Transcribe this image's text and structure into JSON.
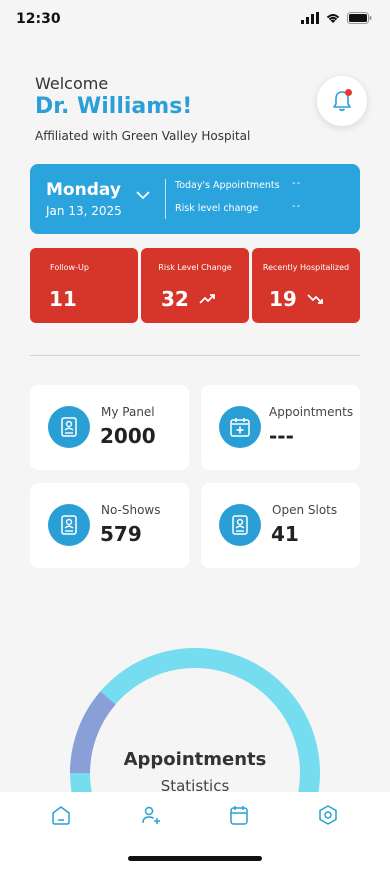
{
  "status": {
    "time": "12:30"
  },
  "header": {
    "welcome": "Welcome",
    "doctor_name": "Dr. Williams!",
    "affiliation": "Affiliated with Green Valley Hospital"
  },
  "day_card": {
    "day": "Monday",
    "date": "Jan 13, 2025",
    "todays_appointments_label": "Today's Appointments",
    "todays_appointments_value": "--",
    "risk_change_label": "Risk level change",
    "risk_change_value": "--",
    "color": "#2ba3dd"
  },
  "alerts": [
    {
      "label": "Follow-Up",
      "value": "11",
      "trend": ""
    },
    {
      "label": "Risk Level Change",
      "value": "32",
      "trend": "up"
    },
    {
      "label": "Recently Hospitalized",
      "value": "19",
      "trend": "down"
    }
  ],
  "alert_color": "#d6352a",
  "stats": [
    {
      "label": "My Panel",
      "value": "2000",
      "icon": "profile-card-icon"
    },
    {
      "label": "Appointments",
      "value": "---",
      "icon": "calendar-plus-icon"
    },
    {
      "label": "No-Shows",
      "value": "579",
      "icon": "profile-card-icon"
    },
    {
      "label": "Open Slots",
      "value": "41",
      "icon": "profile-card-icon"
    }
  ],
  "donut": {
    "title": "Appointments",
    "subtitle": "Statistics",
    "colors": {
      "main": "#76dcef",
      "secondary": "#8a9fd8"
    }
  },
  "tabs": [
    {
      "name": "home",
      "icon": "home-icon"
    },
    {
      "name": "add-patient",
      "icon": "user-plus-icon"
    },
    {
      "name": "calendar",
      "icon": "calendar-icon"
    },
    {
      "name": "settings",
      "icon": "settings-icon"
    }
  ]
}
